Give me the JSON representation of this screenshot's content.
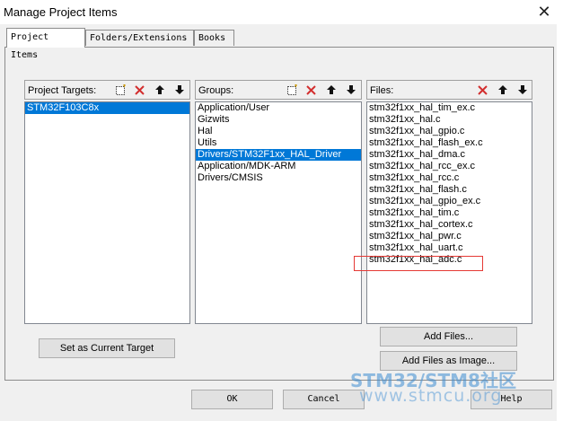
{
  "window": {
    "title": "Manage Project Items",
    "close_glyph": "✕"
  },
  "tabs": [
    {
      "label": "Project Items",
      "active": true
    },
    {
      "label": "Folders/Extensions",
      "active": false
    },
    {
      "label": "Books",
      "active": false
    }
  ],
  "project_targets": {
    "label": "Project Targets:",
    "items": [
      "STM32F103C8x"
    ],
    "selected_index": 0
  },
  "groups": {
    "label": "Groups:",
    "items": [
      "Application/User",
      "Gizwits",
      "Hal",
      "Utils",
      "Drivers/STM32F1xx_HAL_Driver",
      "Application/MDK-ARM",
      "Drivers/CMSIS"
    ],
    "selected_index": 4
  },
  "files": {
    "label": "Files:",
    "items": [
      "stm32f1xx_hal_tim_ex.c",
      "stm32f1xx_hal.c",
      "stm32f1xx_hal_gpio.c",
      "stm32f1xx_hal_flash_ex.c",
      "stm32f1xx_hal_dma.c",
      "stm32f1xx_hal_rcc_ex.c",
      "stm32f1xx_hal_rcc.c",
      "stm32f1xx_hal_flash.c",
      "stm32f1xx_hal_gpio_ex.c",
      "stm32f1xx_hal_tim.c",
      "stm32f1xx_hal_cortex.c",
      "stm32f1xx_hal_pwr.c",
      "stm32f1xx_hal_uart.c",
      "stm32f1xx_hal_adc.c"
    ],
    "highlighted_index": 13
  },
  "buttons": {
    "set_current_target": "Set as Current Target",
    "add_files": "Add Files...",
    "add_files_as_image": "Add Files as Image...",
    "ok": "OK",
    "cancel": "Cancel",
    "help": "Help"
  },
  "watermark": {
    "line1": "STM32/STM8社区",
    "line2": "www.stmcu.org"
  },
  "colors": {
    "selection": "#0078d7",
    "delete_red": "#d32f2f",
    "highlight_box": "#e53935",
    "watermark": "#3c8cd2"
  }
}
